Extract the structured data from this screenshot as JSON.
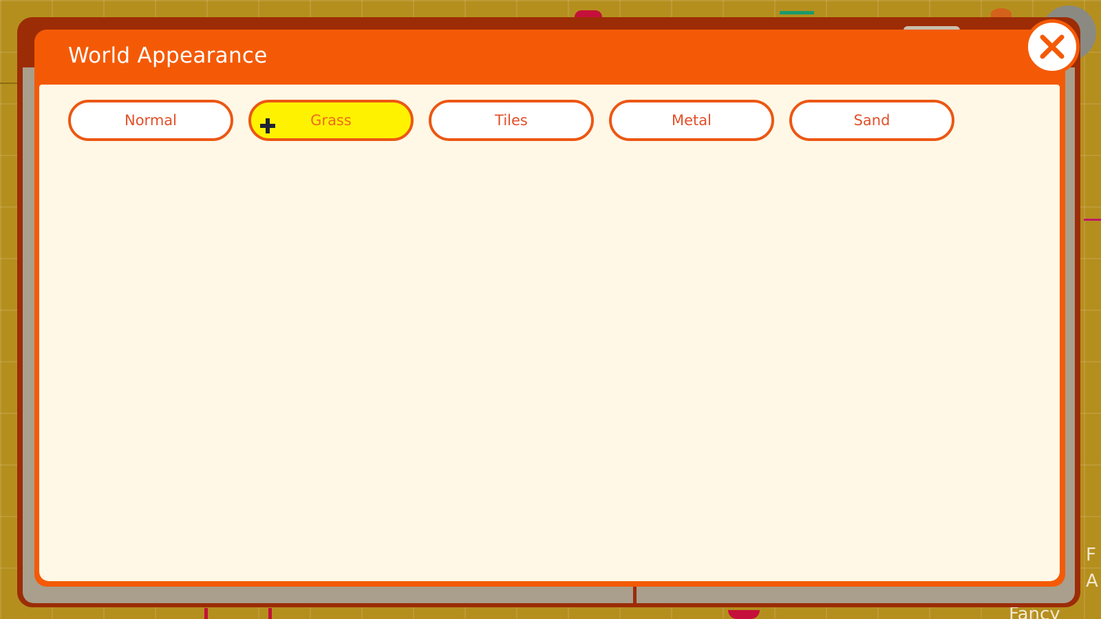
{
  "dialog": {
    "title": "World Appearance",
    "options": [
      {
        "label": "Normal",
        "selected": false
      },
      {
        "label": "Grass",
        "selected": true
      },
      {
        "label": "Tiles",
        "selected": false
      },
      {
        "label": "Metal",
        "selected": false
      },
      {
        "label": "Sand",
        "selected": false
      }
    ],
    "close_icon": "close-icon"
  },
  "background": {
    "edge_texts": [
      "F",
      "A",
      "Fancy"
    ]
  },
  "colors": {
    "accent": "#f45a06",
    "selected": "#fff200",
    "content_bg": "#fff8e6",
    "world_bg": "#b58f1e"
  }
}
